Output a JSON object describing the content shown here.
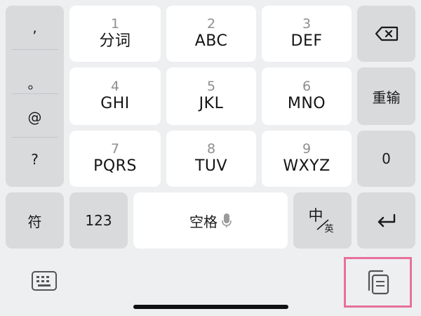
{
  "punctuation": [
    ",",
    "。",
    "@",
    "?"
  ],
  "keys": [
    {
      "digit": "1",
      "letters": "分词"
    },
    {
      "digit": "2",
      "letters": "ABC"
    },
    {
      "digit": "3",
      "letters": "DEF"
    },
    {
      "digit": "4",
      "letters": "GHI"
    },
    {
      "digit": "5",
      "letters": "JKL"
    },
    {
      "digit": "6",
      "letters": "MNO"
    },
    {
      "digit": "7",
      "letters": "PQRS"
    },
    {
      "digit": "8",
      "letters": "TUV"
    },
    {
      "digit": "9",
      "letters": "WXYZ"
    }
  ],
  "right_column": {
    "backspace_icon": "backspace-icon",
    "reenter_label": "重输",
    "zero_label": "0",
    "enter_icon": "enter-return-icon"
  },
  "bottom_row": {
    "symbols_label": "符",
    "numbers_label": "123",
    "space_label": "空格",
    "mic_icon": "microphone-icon",
    "switch_cn": "中",
    "switch_en": "英"
  },
  "toolbar": {
    "keyboard_icon": "keyboard-icon",
    "clipboard_icon": "clipboard-icon"
  },
  "colors": {
    "background": "#eeeff1",
    "key_white": "#ffffff",
    "key_gray": "#d9dadc",
    "highlight": "#e6719a"
  }
}
